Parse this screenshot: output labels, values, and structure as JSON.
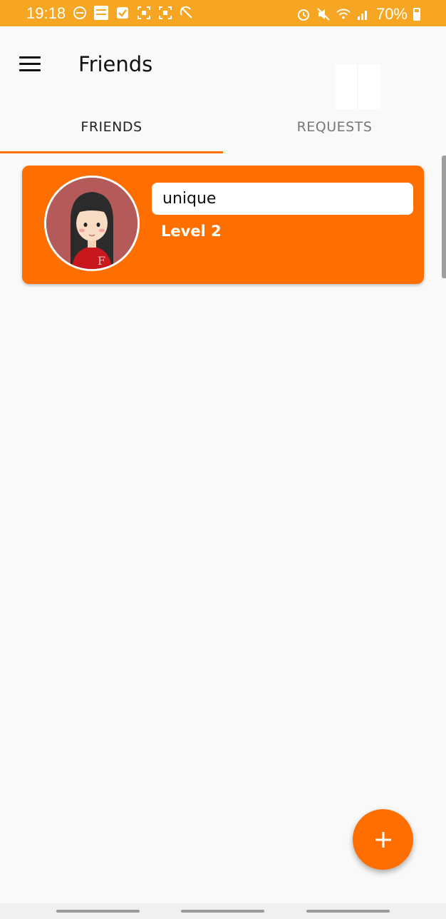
{
  "status_bar": {
    "time": "19:18",
    "battery": "70%",
    "icons_left": [
      "dnd-icon",
      "mobile-app-icon",
      "check-box-icon",
      "screenshot-icon",
      "screenshot-icon",
      "no-sync-icon"
    ],
    "icons_right": [
      "alarm-icon",
      "mute-icon",
      "wifi-icon",
      "signal-icon",
      "battery-icon"
    ]
  },
  "app_bar": {
    "title": "Friends"
  },
  "tabs": [
    {
      "label": "FRIENDS",
      "active": true
    },
    {
      "label": "REQUESTS",
      "active": false
    }
  ],
  "friends": [
    {
      "name": "unique",
      "level": "Level 2"
    }
  ],
  "colors": {
    "accent": "#ff6f00",
    "status_bar": "#f6a623",
    "background": "#f9f9f9"
  },
  "fab": {
    "icon": "plus-icon"
  }
}
